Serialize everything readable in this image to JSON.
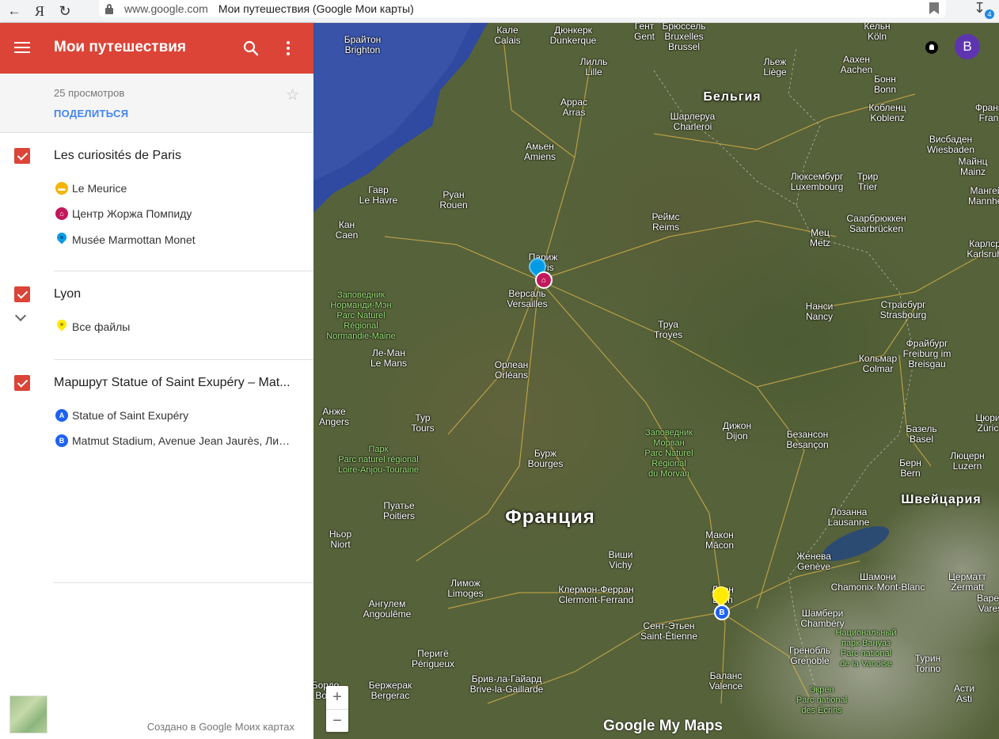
{
  "browser": {
    "domain": "www.google.com",
    "title": "Мои путешествия (Google Мои карты)",
    "ya_label": "Я",
    "download_count": "4"
  },
  "appbar": {
    "title": "Мои путешествия"
  },
  "meta": {
    "views": "25 просмотров",
    "share": "ПОДЕЛИТЬСЯ"
  },
  "layers": [
    {
      "title": "Les curiosités de Paris",
      "checked": true,
      "items": [
        {
          "label": "Le Meurice",
          "icon": "hotel-icon",
          "color": "#f4b400"
        },
        {
          "label": "Центр Жоржа Помпиду",
          "icon": "museum-icon",
          "color": "#c2185b"
        },
        {
          "label": "Musée Marmottan Monet",
          "icon": "pin-icon",
          "color": "#039be5"
        }
      ]
    },
    {
      "title": "Lyon",
      "checked": true,
      "items": [
        {
          "label": "Все файлы",
          "icon": "pin-icon",
          "color": "#ffea00"
        }
      ]
    },
    {
      "title": "Маршрут Statue of Saint Exupéry – Mat...",
      "checked": true,
      "items": [
        {
          "label": "Statue of Saint Exupéry",
          "icon": "route-a-icon",
          "badge": "A",
          "color": "#1e62f0"
        },
        {
          "label": "Matmut Stadium, Avenue Jean Jaurès, Лио...",
          "icon": "route-b-icon",
          "badge": "B",
          "color": "#1e62f0"
        }
      ]
    }
  ],
  "footer": {
    "text": "Создано в Google Моих картах"
  },
  "map": {
    "logo": "Google My Maps",
    "zoom_in": "+",
    "zoom_out": "−",
    "avatar_letter": "B",
    "countries": [
      {
        "name": "Франция"
      },
      {
        "name": "Бельгия"
      },
      {
        "name": "Швейцария"
      }
    ],
    "places": [
      "Брайтон\nBrighton",
      "Кале\nCalais",
      "Дюнкерк\nDunkerque",
      "Гент\nGent",
      "Брюссель\nBruxelles\nBrussel",
      "Кельн\nKöln",
      "Лилль\nLille",
      "Льеж\nLiège",
      "Аахен\nAachen",
      "Бонн\nBonn",
      "Аррас\nArras",
      "Шарлеруа\nCharleroi",
      "Кобленц\nKoblenz",
      "Франк\nFran",
      "Висбаден\nWiesbaden",
      "Майнц\nMainz",
      "Амьен\nAmiens",
      "Гавр\nLe Havre",
      "Руан\nRouen",
      "Люксембург\nLuxembourg",
      "Трир\nTrier",
      "Мангей\nMannhei",
      "Кан\nCaen",
      "Реймс\nReims",
      "Саарбрюккен\nSaarbrücken",
      "Мец\nMetz",
      "Карлсру\nKarlsruhe",
      "Париж\nParis",
      "Версаль\nVersailles",
      "Нанси\nNancy",
      "Страсбург\nStrasbourg",
      "Труа\nTroyes",
      "Ле-Ман\nLe Mans",
      "Фрайбург\nFreiburg im\nBreisgau",
      "Кольмар\nColmar",
      "Орлеан\nOrléans",
      "Анже\nAngers",
      "Тур\nTours",
      "Дижон\nDijon",
      "Безансон\nBesançon",
      "Цюри\nZüric",
      "Базель\nBasel",
      "Люцерн\nLuzern",
      "Бурж\nBourges",
      "Берн\nBern",
      "Пуатье\nPoitiers",
      "Лозанна\nLausanne",
      "Ньор\nNiort",
      "Макон\nMâcon",
      "Женева\nGenève",
      "Виши\nVichy",
      "Лимож\nLimoges",
      "Клермон-Ферран\nClermont-Ferrand",
      "Лион\nLyon",
      "Шамони\nChamonix-Mont-Blanc",
      "Церматт\nZermatt",
      "Варес\nVares",
      "Ангулем\nAngoulême",
      "Шамбери\nChambéry",
      "Сент-Этьен\nSaint-Étienne",
      "Перигё\nPérigueux",
      "Гренобль\nGrenoble",
      "Турин\nTorino",
      "Бержерак\nBergerac",
      "Брив-ла-Гайард\nBrive-la-Gaillarde",
      "Баланс\nValence",
      "Асти\nAsti",
      "Бордо\nBord"
    ],
    "parks": [
      "Заповедник\nНорманди-Мэн\nParc Naturel\nRégional\nNormandie-Maine",
      "Парк\nParc naturel régional\nLoire-Anjou-Touraine",
      "Заповедник\nМорван\nParc Naturel\nRégional\ndu Morvan",
      "Национальный\nпарк Вануаз\nParc national\nde la Vanoise",
      "Экрен\nParc national\ndes Écrins"
    ]
  }
}
